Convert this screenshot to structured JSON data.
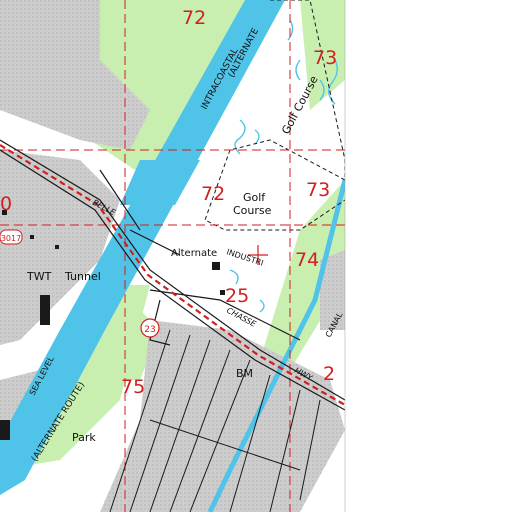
{
  "map": {
    "labels": {
      "intracoastal": "INTRACOASTAL",
      "alternate_route_top": "(ALTERNATE",
      "alternate_route_bottom": "(ALTERNATE ROUTE)",
      "golf_course_top": "Golf Course",
      "golf_course_mid_1": "Golf",
      "golf_course_mid_2": "Course",
      "alternate_school": "Alternate",
      "industrial": "INDUSTRI",
      "belle": "BELLE",
      "chasse": "CHASSE",
      "hwy": "HWY",
      "canal": "CANAL",
      "sea_level": "SEA LEVEL",
      "tunnel": "Tunnel",
      "twt": "TWT",
      "bm": "BM",
      "park": "Park",
      "route_23": "23",
      "route_3017": "3017"
    },
    "section_numbers": {
      "s72_top": "72",
      "s73_top": "73",
      "s72_mid": "72",
      "s73_mid": "73",
      "s74": "74",
      "s25": "25",
      "s75": "75",
      "s2": "2",
      "s0": "0"
    },
    "colors": {
      "water": "#4fc3e8",
      "vegetation": "#c9efb0",
      "urban": "#c8c8c8",
      "boundary": "#d21e1e",
      "road": "#1a1a1a"
    },
    "map_symbol": "centered cross marker"
  }
}
